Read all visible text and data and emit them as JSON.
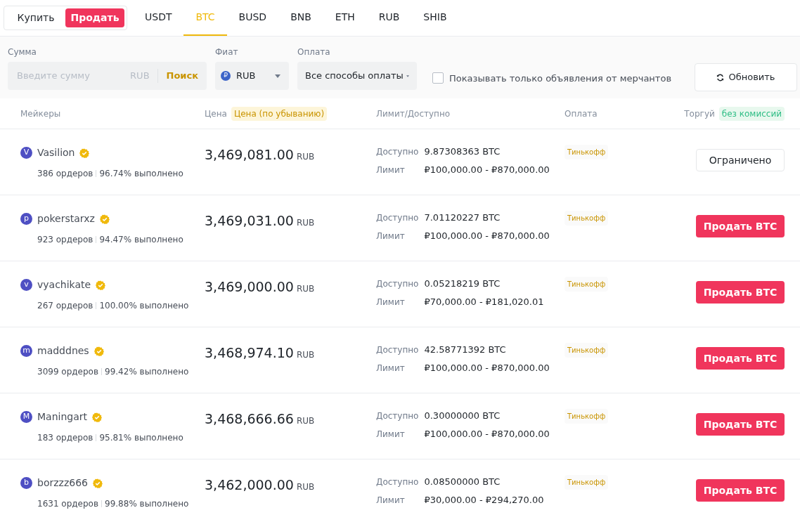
{
  "side_toggle": [
    {
      "label": "Купить",
      "selected": false
    },
    {
      "label": "Продать",
      "selected": true
    }
  ],
  "assets": [
    {
      "label": "USDT",
      "selected": false
    },
    {
      "label": "BTC",
      "selected": true
    },
    {
      "label": "BUSD",
      "selected": false
    },
    {
      "label": "BNB",
      "selected": false
    },
    {
      "label": "ETH",
      "selected": false
    },
    {
      "label": "RUB",
      "selected": false
    },
    {
      "label": "SHIB",
      "selected": false
    }
  ],
  "filters": {
    "amount": {
      "label": "Сумма",
      "placeholder": "Введите сумму",
      "unit": "RUB",
      "search_button": "Поиск"
    },
    "fiat": {
      "label": "Фиат",
      "symbol": "₽",
      "value": "RUB"
    },
    "payment": {
      "label": "Оплата",
      "value": "Все способы оплаты"
    },
    "merchants_only": {
      "label": "Показывать только объявления от мерчантов",
      "checked": false
    },
    "refresh_button": "Обновить"
  },
  "table": {
    "columns": {
      "makers": "Мейкеры",
      "price": "Цена",
      "price_sort": "Цена (по убыванию)",
      "limit": "Лимит/Доступно",
      "payment": "Оплата",
      "trade": "Торгуй",
      "trade_badge": "без комиссий"
    },
    "rows": [
      {
        "initial": "V",
        "name": "Vasilion",
        "orders": "386 ордеров",
        "completion": "96.74% выполнено",
        "price": "3,469,081.00",
        "currency": "RUB",
        "available_label": "Доступно",
        "available": "9.87308363 BTC",
        "limit_label": "Лимит",
        "limit": "₽100,000.00 - ₽870,000.00",
        "payment": "Тинькофф",
        "action": {
          "kind": "restricted",
          "label": "Ограничено"
        }
      },
      {
        "initial": "p",
        "name": "pokerstarxz",
        "orders": "923 ордеров",
        "completion": "94.47% выполнено",
        "price": "3,469,031.00",
        "currency": "RUB",
        "available_label": "Доступно",
        "available": "7.01120227 BTC",
        "limit_label": "Лимит",
        "limit": "₽100,000.00 - ₽870,000.00",
        "payment": "Тинькофф",
        "action": {
          "kind": "sell",
          "label": "Продать BTC"
        }
      },
      {
        "initial": "v",
        "name": "vyachikate",
        "orders": "267 ордеров",
        "completion": "100.00% выполнено",
        "price": "3,469,000.00",
        "currency": "RUB",
        "available_label": "Доступно",
        "available": "0.05218219 BTC",
        "limit_label": "Лимит",
        "limit": "₽70,000.00 - ₽181,020.01",
        "payment": "Тинькофф",
        "action": {
          "kind": "sell",
          "label": "Продать BTC"
        }
      },
      {
        "initial": "m",
        "name": "madddnes",
        "orders": "3099 ордеров",
        "completion": "99.42% выполнено",
        "price": "3,468,974.10",
        "currency": "RUB",
        "available_label": "Доступно",
        "available": "42.58771392 BTC",
        "limit_label": "Лимит",
        "limit": "₽100,000.00 - ₽870,000.00",
        "payment": "Тинькофф",
        "action": {
          "kind": "sell",
          "label": "Продать BTC"
        }
      },
      {
        "initial": "M",
        "name": "Maningart",
        "orders": "183 ордеров",
        "completion": "95.81% выполнено",
        "price": "3,468,666.66",
        "currency": "RUB",
        "available_label": "Доступно",
        "available": "0.30000000 BTC",
        "limit_label": "Лимит",
        "limit": "₽100,000.00 - ₽870,000.00",
        "payment": "Тинькофф",
        "action": {
          "kind": "sell",
          "label": "Продать BTC"
        }
      },
      {
        "initial": "b",
        "name": "borzzz666",
        "orders": "1631 ордеров",
        "completion": "99.88% выполнено",
        "price": "3,462,000.00",
        "currency": "RUB",
        "available_label": "Доступно",
        "available": "0.08500000 BTC",
        "limit_label": "Лимит",
        "limit": "₽30,000.00 - ₽294,270.00",
        "payment": "Тинькофф",
        "action": {
          "kind": "sell",
          "label": "Продать BTC"
        }
      }
    ]
  }
}
